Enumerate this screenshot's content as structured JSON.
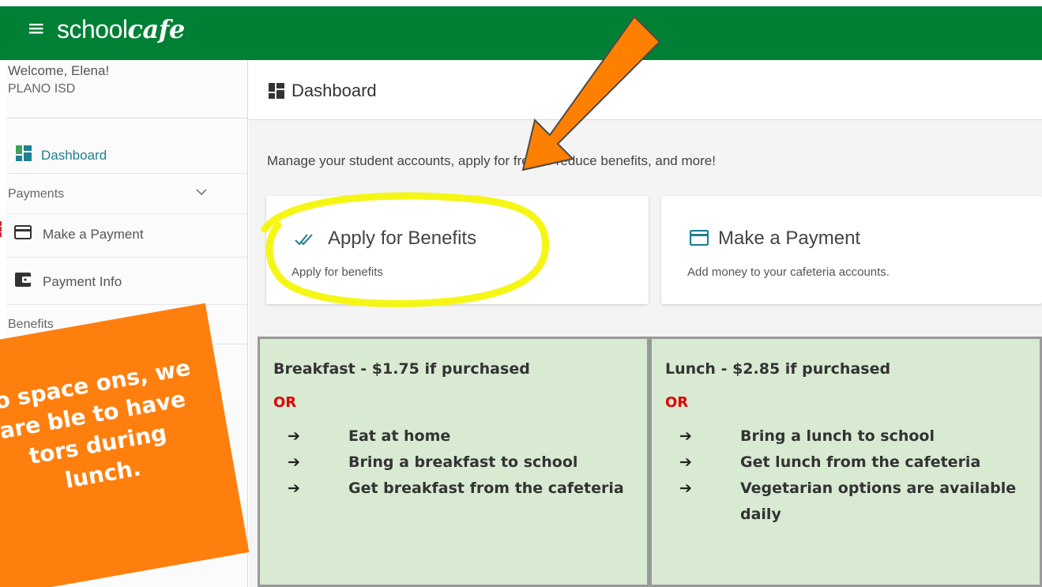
{
  "app": {
    "brand_prefix": "school",
    "brand_suffix": "cafe",
    "menu_icon": "hamburger-icon",
    "topbar_color": "#008035"
  },
  "sidebar": {
    "welcome": "Welcome, Elena!",
    "district": "PLANO ISD",
    "dashboard_label": "Dashboard",
    "payments_section": "Payments",
    "make_payment_label": "Make a Payment",
    "payment_info_label": "Payment Info",
    "benefits_section": "Benefits",
    "active_color": "#1e7f8f"
  },
  "main": {
    "title": "Dashboard",
    "subtitle": "Manage your student accounts, apply for free or reduce benefits, and more!",
    "cards": [
      {
        "title": "Apply for Benefits",
        "description": "Apply for benefits",
        "icon": "double-check-icon"
      },
      {
        "title": "Make a Payment",
        "description": "Add money to your cafeteria accounts.",
        "icon": "credit-card-icon"
      }
    ]
  },
  "note": {
    "text": "to space ons, we are ble to have tors during lunch.",
    "color": "#ff7f0e"
  },
  "meals": [
    {
      "heading": "Breakfast - $1.75 if purchased",
      "or": "OR",
      "options": [
        "Eat at home",
        "Bring a breakfast to school",
        "Get breakfast from the cafeteria"
      ]
    },
    {
      "heading": "Lunch - $2.85 if purchased",
      "or": "OR",
      "options": [
        "Bring a lunch to school",
        "Get lunch from the cafeteria",
        "Vegetarian options are available daily"
      ]
    }
  ],
  "arrow_glyph": "➔",
  "annotation_colors": {
    "arrow": "#ff8000",
    "highlight": "#f5f50a"
  }
}
